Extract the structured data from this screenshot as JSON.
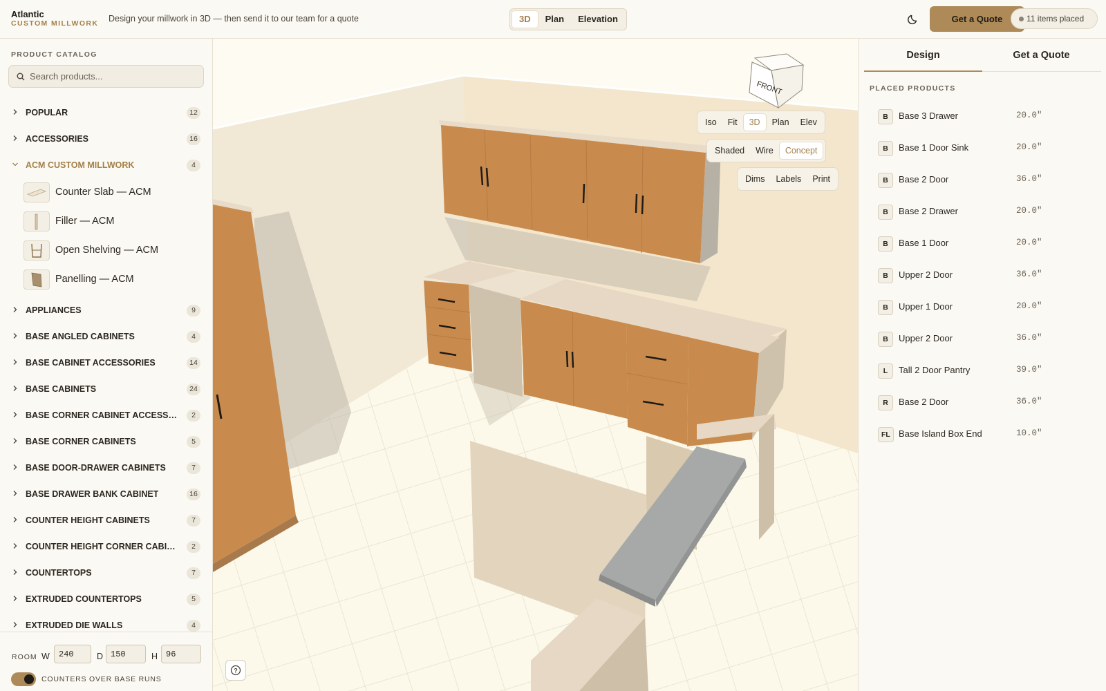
{
  "brand": {
    "name": "Atlantic",
    "sub": "CUSTOM MILLWORK"
  },
  "tagline": "Design your millwork in 3D — then send it to our team for a quote",
  "view_modes": [
    {
      "label": "3D",
      "active": true
    },
    {
      "label": "Plan",
      "active": false
    },
    {
      "label": "Elevation",
      "active": false
    }
  ],
  "header": {
    "quote_label": "Get a Quote",
    "items_placed": "11 items placed",
    "theme_icon": "moon-icon"
  },
  "catalog": {
    "title": "PRODUCT CATALOG",
    "search_placeholder": "Search products...",
    "categories": [
      {
        "label": "POPULAR",
        "count": "12",
        "open": false
      },
      {
        "label": "ACCESSORIES",
        "count": "16",
        "open": false
      },
      {
        "label": "ACM CUSTOM MILLWORK",
        "count": "4",
        "open": true
      },
      {
        "label": "APPLIANCES",
        "count": "9",
        "open": false
      },
      {
        "label": "BASE ANGLED CABINETS",
        "count": "4",
        "open": false
      },
      {
        "label": "BASE CABINET ACCESSORIES",
        "count": "14",
        "open": false
      },
      {
        "label": "BASE CABINETS",
        "count": "24",
        "open": false
      },
      {
        "label": "BASE CORNER CABINET ACCESSO...",
        "count": "2",
        "open": false
      },
      {
        "label": "BASE CORNER CABINETS",
        "count": "5",
        "open": false
      },
      {
        "label": "BASE DOOR-DRAWER CABINETS",
        "count": "7",
        "open": false
      },
      {
        "label": "BASE DRAWER BANK CABINET",
        "count": "16",
        "open": false
      },
      {
        "label": "COUNTER HEIGHT CABINETS",
        "count": "7",
        "open": false
      },
      {
        "label": "COUNTER HEIGHT CORNER CABIN...",
        "count": "2",
        "open": false
      },
      {
        "label": "COUNTERTOPS",
        "count": "7",
        "open": false
      },
      {
        "label": "EXTRUDED COUNTERTOPS",
        "count": "5",
        "open": false
      },
      {
        "label": "EXTRUDED DIE WALLS",
        "count": "4",
        "open": false
      }
    ],
    "acm_items": [
      {
        "label": "Counter Slab — ACM"
      },
      {
        "label": "Filler — ACM"
      },
      {
        "label": "Open Shelving — ACM"
      },
      {
        "label": "Panelling — ACM"
      }
    ]
  },
  "room": {
    "label": "ROOM",
    "w_label": "W",
    "w": "240",
    "d_label": "D",
    "d": "150",
    "h_label": "H",
    "h": "96",
    "toggle_label": "COUNTERS OVER BASE RUNS",
    "toggle_on": true
  },
  "viewport": {
    "cube_front": "FRONT",
    "camera_tools": [
      {
        "label": "Iso",
        "active": false
      },
      {
        "label": "Fit",
        "active": false
      },
      {
        "label": "3D",
        "active": true
      },
      {
        "label": "Plan",
        "active": false
      },
      {
        "label": "Elev",
        "active": false
      }
    ],
    "render_tools": [
      {
        "label": "Shaded",
        "active": false
      },
      {
        "label": "Wire",
        "active": false
      },
      {
        "label": "Concept",
        "active": true
      }
    ],
    "overlay_tools": [
      {
        "label": "Dims",
        "active": false
      },
      {
        "label": "Labels",
        "active": false
      },
      {
        "label": "Print",
        "active": false
      }
    ],
    "help": "?"
  },
  "right_panel": {
    "tabs": [
      {
        "label": "Design",
        "active": true
      },
      {
        "label": "Get a Quote",
        "active": false
      }
    ],
    "placed_title": "PLACED PRODUCTS",
    "placed": [
      {
        "badge": "B",
        "name": "Base 3 Drawer",
        "dim": "20.0\""
      },
      {
        "badge": "B",
        "name": "Base 1 Door Sink",
        "dim": "20.0\""
      },
      {
        "badge": "B",
        "name": "Base 2 Door",
        "dim": "36.0\""
      },
      {
        "badge": "B",
        "name": "Base 2 Drawer",
        "dim": "20.0\""
      },
      {
        "badge": "B",
        "name": "Base 1 Door",
        "dim": "20.0\""
      },
      {
        "badge": "B",
        "name": "Upper 2 Door",
        "dim": "36.0\""
      },
      {
        "badge": "B",
        "name": "Upper 1 Door",
        "dim": "20.0\""
      },
      {
        "badge": "B",
        "name": "Upper 2 Door",
        "dim": "36.0\""
      },
      {
        "badge": "L",
        "name": "Tall 2 Door Pantry",
        "dim": "39.0\""
      },
      {
        "badge": "R",
        "name": "Base 2 Door",
        "dim": "36.0\""
      },
      {
        "badge": "FL",
        "name": "Base Island Box End",
        "dim": "10.0\""
      }
    ]
  },
  "colors": {
    "accent": "#ad8a58",
    "cabinet": "#c98b4d",
    "counter": "#e6d8c4",
    "wall": "#f1e6d0",
    "floor": "#fbf8e9"
  }
}
